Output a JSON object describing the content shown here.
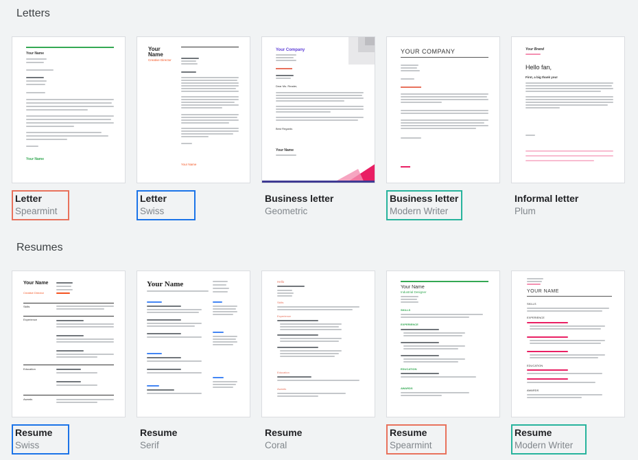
{
  "sections": {
    "letters": {
      "title": "Letters"
    },
    "resumes": {
      "title": "Resumes"
    }
  },
  "letters": [
    {
      "name": "Letter",
      "style": "Spearmint",
      "highlight": "#e8715b"
    },
    {
      "name": "Letter",
      "style": "Swiss",
      "highlight": "#1a73e8"
    },
    {
      "name": "Business letter",
      "style": "Geometric",
      "highlight": null
    },
    {
      "name": "Business letter",
      "style": "Modern Writer",
      "highlight": "#26b39c"
    },
    {
      "name": "Informal letter",
      "style": "Plum",
      "highlight": null
    }
  ],
  "resumes": [
    {
      "name": "Resume",
      "style": "Swiss",
      "highlight": "#1a73e8"
    },
    {
      "name": "Resume",
      "style": "Serif",
      "highlight": null
    },
    {
      "name": "Resume",
      "style": "Coral",
      "highlight": null
    },
    {
      "name": "Resume",
      "style": "Spearmint",
      "highlight": "#e8715b"
    },
    {
      "name": "Resume",
      "style": "Modern Writer",
      "highlight": "#26b39c"
    }
  ],
  "previews": {
    "letter_spearmint": {
      "sender": "Your Name",
      "signature": "Your Name"
    },
    "letter_swiss": {
      "name": "Your Name",
      "role": "Creative Director",
      "footer": "Your Name"
    },
    "letter_geometric": {
      "company": "Your Company",
      "greeting": "Dear Ms. Reader,",
      "signoff": "Best Regards",
      "name": "Your Name"
    },
    "letter_modern": {
      "company": "YOUR COMPANY"
    },
    "letter_plum": {
      "brand": "Your Brand",
      "greeting": "Hello fan,",
      "subhead": "First, a big thank you!"
    },
    "resume_swiss": {
      "name": "Your Name",
      "role": "Creative Director",
      "sections": [
        "Skills",
        "Experience",
        "Education",
        "Awards"
      ]
    },
    "resume_serif": {
      "name": "Your Name"
    },
    "resume_coral": {
      "name": "Hello",
      "sections": [
        "Skills",
        "Experience",
        "Education",
        "Awards"
      ]
    },
    "resume_spearmint": {
      "name": "Your Name",
      "role": "Industrial Designer",
      "sections": [
        "SKILLS",
        "EXPERIENCE",
        "EDUCATION",
        "AWARDS"
      ]
    },
    "resume_modern": {
      "name": "YOUR NAME",
      "sections": [
        "SKILLS",
        "EXPERIENCE",
        "EDUCATION",
        "AWARDS"
      ]
    }
  },
  "colors": {
    "background": "#f1f3f4",
    "spearmint": "#34a853",
    "swiss_accent": "#f4511e",
    "geometric_accent": "#5b3bd6",
    "coral": "#e8715b",
    "plum_pink": "#e91e63",
    "card_border": "#dadce0"
  }
}
